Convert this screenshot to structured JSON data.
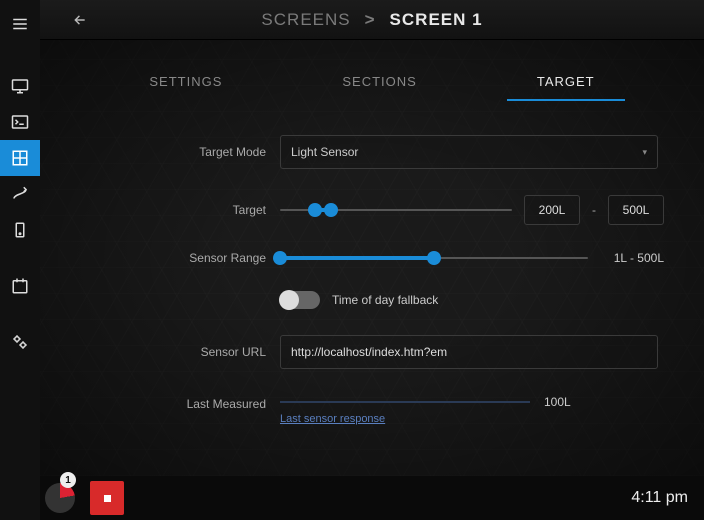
{
  "header": {
    "crumb_root": "SCREENS",
    "crumb_sep": ">",
    "crumb_current": "SCREEN 1"
  },
  "tabs": {
    "settings": "SETTINGS",
    "sections": "SECTIONS",
    "target": "TARGET"
  },
  "form": {
    "target_mode_label": "Target Mode",
    "target_mode_value": "Light Sensor",
    "target_label": "Target",
    "target_min_box": "200L",
    "target_max_box": "500L",
    "dash": "-",
    "sensor_range_label": "Sensor Range",
    "sensor_range_text": "1L - 500L",
    "fallback_label": "Time of day fallback",
    "sensor_url_label": "Sensor URL",
    "sensor_url_value": "http://localhost/index.htm?em",
    "last_measured_label": "Last Measured",
    "last_measured_value": "100L",
    "last_sensor_link": "Last sensor response"
  },
  "footer": {
    "badge": "1",
    "clock": "4:11 pm"
  }
}
